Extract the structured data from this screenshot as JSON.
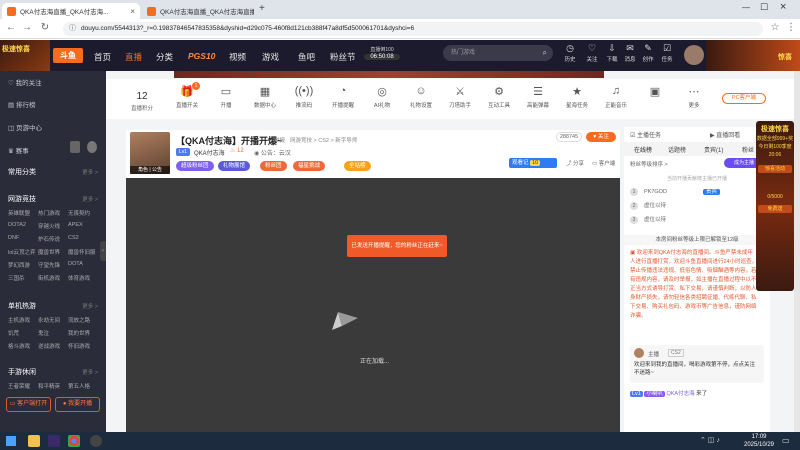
{
  "browser": {
    "tabs": [
      {
        "title": "QKA付志海直播_QKA付志海..."
      },
      {
        "title": "QKA付志海直播_QKA付志海直播..."
      }
    ],
    "url": "douyu.com/5544313?_r=0.19837846547835358&dyshid=d29c075-460f8d121cb388f47a8df5d500061701&dyshci=6"
  },
  "header": {
    "banner_text": "极速惊喜",
    "logo": "斗鱼",
    "nav": [
      "首页",
      "直播",
      "分类",
      "PGS10",
      "视频",
      "游戏",
      "鱼吧",
      "粉丝节"
    ],
    "live_badge_line1": "直播倒100",
    "live_badge_line2": "06:50:08",
    "search_placeholder": "热门游戏",
    "icons": [
      {
        "label": "历史",
        "icon": "clock-icon"
      },
      {
        "label": "关注",
        "icon": "heart-icon"
      },
      {
        "label": "下载",
        "icon": "download-icon"
      },
      {
        "label": "消息",
        "icon": "message-icon"
      },
      {
        "label": "创作",
        "icon": "create-icon"
      },
      {
        "label": "任务",
        "icon": "task-icon"
      }
    ],
    "promo_right": "惊喜"
  },
  "sidebar": {
    "top_items": [
      "我的关注",
      "排行榜",
      "页游中心",
      "赛事"
    ],
    "sections": [
      {
        "title": "常用分类",
        "more": "更多 >",
        "items": []
      },
      {
        "title": "网游竞技",
        "more": "更多 >",
        "items": [
          "英雄联盟",
          "热门游戏",
          "无畏契约",
          "DOTA2",
          "穿越火线",
          "APEX",
          "DNF",
          "炉石传说",
          "CS2",
          "lol云顶之弈",
          "魔兽世界",
          "魔兽怀旧服",
          "梦幻西游",
          "守望先锋",
          "DOTA",
          "三国杀",
          "街机游戏",
          "体育游戏"
        ]
      },
      {
        "title": "单机热游",
        "more": "更多 >",
        "items": [
          "主机游戏",
          "永劫无间",
          "流放之路",
          "饥荒",
          "鬼泣",
          "我的世界",
          "格斗游戏",
          "逆战游戏",
          "怀旧游戏"
        ]
      },
      {
        "title": "手游休闲",
        "more": "更多 >",
        "items": [
          "王者荣耀",
          "和平精英",
          "第五人格"
        ]
      }
    ],
    "btn_client": "客户端打开",
    "btn_live": "我要开播"
  },
  "toolbar": {
    "score_value": "12",
    "score_label": "直播积分",
    "items": [
      {
        "label": "直播开关",
        "icon": "gift-icon",
        "badge": "1"
      },
      {
        "label": "开播",
        "icon": "tv-icon"
      },
      {
        "label": "数据中心",
        "icon": "chart-icon"
      },
      {
        "label": "推流码",
        "icon": "signal-icon"
      },
      {
        "label": "开播提醒",
        "icon": "bell-icon"
      },
      {
        "label": "AI礼物",
        "icon": "ai-icon"
      },
      {
        "label": "礼物设置",
        "icon": "robot-icon"
      },
      {
        "label": "刀塔助手",
        "icon": "sword-icon"
      },
      {
        "label": "互动工具",
        "icon": "tools-icon"
      },
      {
        "label": "高能弹幕",
        "icon": "danmu-icon"
      },
      {
        "label": "星海任务",
        "icon": "star-icon"
      },
      {
        "label": "正能音乐",
        "icon": "music-icon"
      },
      {
        "label": "",
        "icon": "box-icon"
      },
      {
        "label": "更多",
        "icon": "more-icon"
      }
    ],
    "pc_badge": "PC客户端"
  },
  "room": {
    "avatar_caption": "角色 | 公告",
    "title": "【QKA付志海】开播开爆~",
    "title_tag": "举报",
    "category": "网游竞技 > CS2 > 新字导师",
    "level_badge": "Lv1",
    "anchor_name": "QKA付志海",
    "hot_count": "12",
    "announce": "公告：云汉",
    "view_count": "288745",
    "follow_label": "关注",
    "share_label": "分享",
    "client_label": "客户端",
    "tags": [
      {
        "text": "超级粉丝团",
        "color": "#7c5ef0"
      },
      {
        "text": "礼物展馆",
        "color": "#5a5ad8"
      },
      {
        "text": "粉丝团",
        "color": "#f0673c"
      },
      {
        "text": "福星挑战",
        "color": "#f0673c"
      },
      {
        "text": "全站榜",
        "color": "#f7a21b"
      }
    ],
    "right_tag": "观看记",
    "right_tag_count": "10"
  },
  "video": {
    "notice": "已发送开播提醒，您的粉丝正在赶来~",
    "loading": "正在加载..."
  },
  "right_panel": {
    "header_tabs": [
      "主播任务",
      "直播回看"
    ],
    "tabs": [
      "在线榜",
      "话题榜",
      "贵宾(1)",
      "粉丝"
    ],
    "subtitle": "粉丝等级排序 >",
    "contribute_btn": "成为主播",
    "list_hint": "当前开播贡献榜主播已开播",
    "ranks": [
      {
        "rank": "1",
        "name": "PK7GOD",
        "badge": "贵宾"
      },
      {
        "rank": "2",
        "name": "虚位以待",
        "badge": ""
      },
      {
        "rank": "3",
        "name": "虚位以待",
        "badge": ""
      }
    ],
    "notice": "本房间粉丝等级上限已解锁至12级",
    "chat_system": "欢迎来到QKA付志海的直播间。斗鱼严禁未成年人进行直播打赏，欢迎斗鱼直播间进行24小时巡查，禁止传播违法违规、低俗色情、吸烟酗酒等内容，若有违规内容，请及时举报，如主播在直播过程中以不正当方式诱导打赏、私下交易，请谨慎判断，以防人身财产损失，请勿轻信各类招聘征婚、代练代聊、私下交易、购买礼包码、游戏币等广告信息，谨防网络诈骗。",
    "user_name": "主播",
    "user_tag": "CS2",
    "user_msg": "欢迎来到我的直播间，喝彩游戏第不停，点点关注不迷路~",
    "enter_badge": "Lv1",
    "enter_badge2": "小喇叭",
    "enter_name": "QKA付志海",
    "enter_suffix": "来了"
  },
  "promo": {
    "line1": "极速惊喜",
    "line2": "数据全部999+奖",
    "line3": "今日剩100季度",
    "line4": "20:06",
    "line5": "惊喜活动",
    "line6": "0/5000",
    "line7": "免费送"
  },
  "taskbar": {
    "time": "17:09",
    "date": "2025/10/29"
  },
  "colors": {
    "brand": "#f56c1f",
    "header_bg": "#1b1b2d",
    "sidebar_bg": "#2b2c3a"
  }
}
